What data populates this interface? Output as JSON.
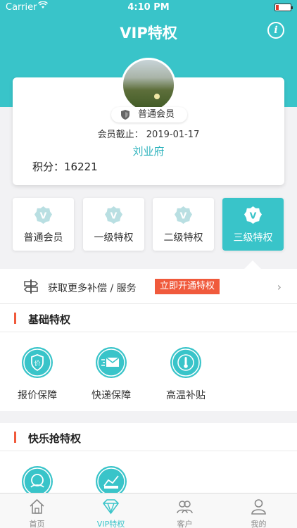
{
  "status": {
    "carrier": "Carrier",
    "time": "4:10 PM"
  },
  "nav": {
    "title": "VIP特权",
    "info_icon": "info-icon"
  },
  "profile": {
    "badge": "普通会员",
    "expire": "会员截止：  2019-01-17",
    "name": "刘业府",
    "points": "积分：16221"
  },
  "tiers": [
    {
      "label": "普通会员",
      "active": false
    },
    {
      "label": "一级特权",
      "active": false
    },
    {
      "label": "二级特权",
      "active": false
    },
    {
      "label": "三级特权",
      "active": true
    }
  ],
  "promo": {
    "text": "获取更多补偿 / 服务",
    "button": "立即开通特权"
  },
  "basic": {
    "title": "基础特权",
    "items": [
      {
        "label": "报价保障",
        "icon": "price-guarantee-icon"
      },
      {
        "label": "快递保障",
        "icon": "express-guarantee-icon"
      },
      {
        "label": "高温补贴",
        "icon": "heat-subsidy-icon"
      }
    ]
  },
  "happy": {
    "title": "快乐抢特权",
    "items": [
      {
        "label": "",
        "icon": "happy-face-icon"
      },
      {
        "label": "",
        "icon": "chart-icon"
      }
    ]
  },
  "tabbar": [
    {
      "label": "首页",
      "icon": "home-icon",
      "active": false
    },
    {
      "label": "VIP特权",
      "icon": "vip-diamond-icon",
      "active": true
    },
    {
      "label": "客户",
      "icon": "customers-icon",
      "active": false
    },
    {
      "label": "我的",
      "icon": "profile-icon",
      "active": false
    }
  ],
  "colors": {
    "accent": "#39c4c9",
    "promo_button": "#f05a3c"
  }
}
